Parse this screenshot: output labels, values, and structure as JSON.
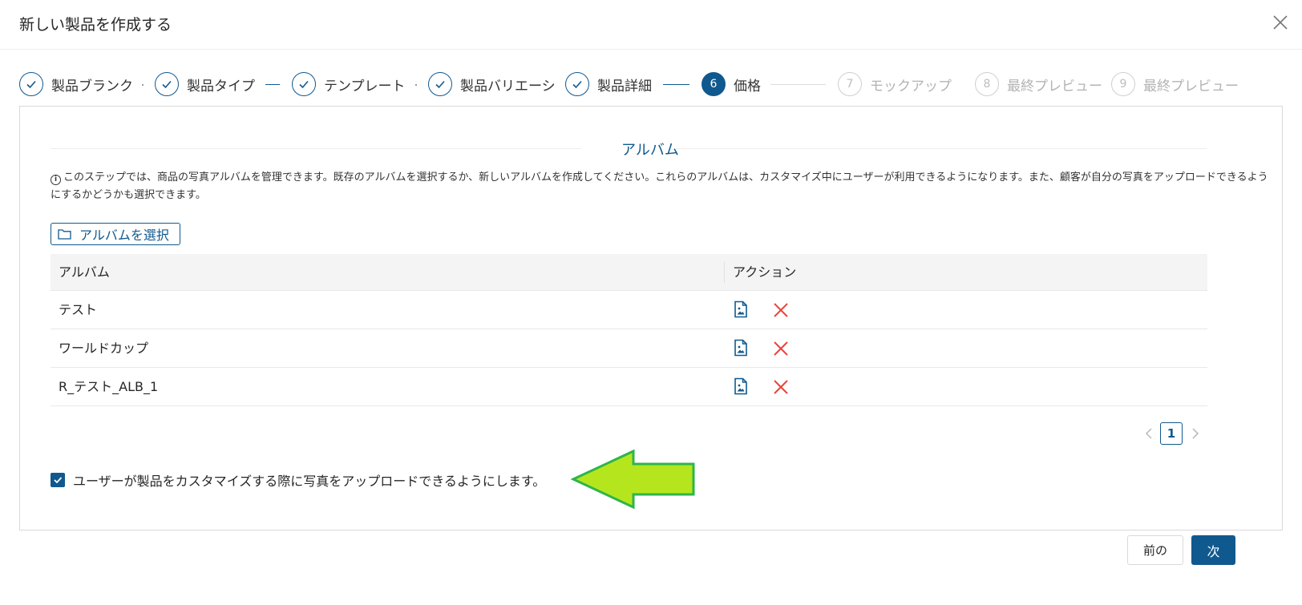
{
  "modal": {
    "title": "新しい製品を作成する"
  },
  "steps": [
    {
      "number": "1",
      "title": "製品ブランク",
      "status": "finished"
    },
    {
      "number": "2",
      "title": "製品タイプ",
      "status": "finished"
    },
    {
      "number": "3",
      "title": "テンプレート",
      "status": "finished"
    },
    {
      "number": "4",
      "title": "製品バリエーシ",
      "status": "finished"
    },
    {
      "number": "5",
      "title": "製品詳細",
      "status": "finished"
    },
    {
      "number": "6",
      "title": "価格",
      "status": "current"
    },
    {
      "number": "7",
      "title": "モックアップ",
      "status": "pending"
    },
    {
      "number": "8",
      "title": "最終プレビュー",
      "status": "pending"
    },
    {
      "number": "9",
      "title": "最終プレビュー",
      "status": "pending"
    }
  ],
  "section": {
    "title": "アルバム",
    "info": "このステップでは、商品の写真アルバムを管理できます。既存のアルバムを選択するか、新しいアルバムを作成してください。これらのアルバムは、カスタマイズ中にユーザーが利用できるようになります。また、顧客が自分の写真をアップロードできるようにするかどうかも選択できます。",
    "select_button": "アルバムを選択"
  },
  "table": {
    "columns": [
      "アルバム",
      "アクション"
    ],
    "rows": [
      {
        "name": "テスト"
      },
      {
        "name": "ワールドカップ"
      },
      {
        "name": "R_テスト_ALB_1"
      }
    ]
  },
  "pagination": {
    "current_page": "1"
  },
  "upload_option": {
    "checked": true,
    "label": "ユーザーが製品をカスタマイズする際に写真をアップロードできるようにします。"
  },
  "footer": {
    "prev_label": "前の",
    "next_label": "次"
  },
  "colors": {
    "primary": "#10598f",
    "delete": "#e8453c",
    "annotation_arrow": "#b5e61d"
  }
}
